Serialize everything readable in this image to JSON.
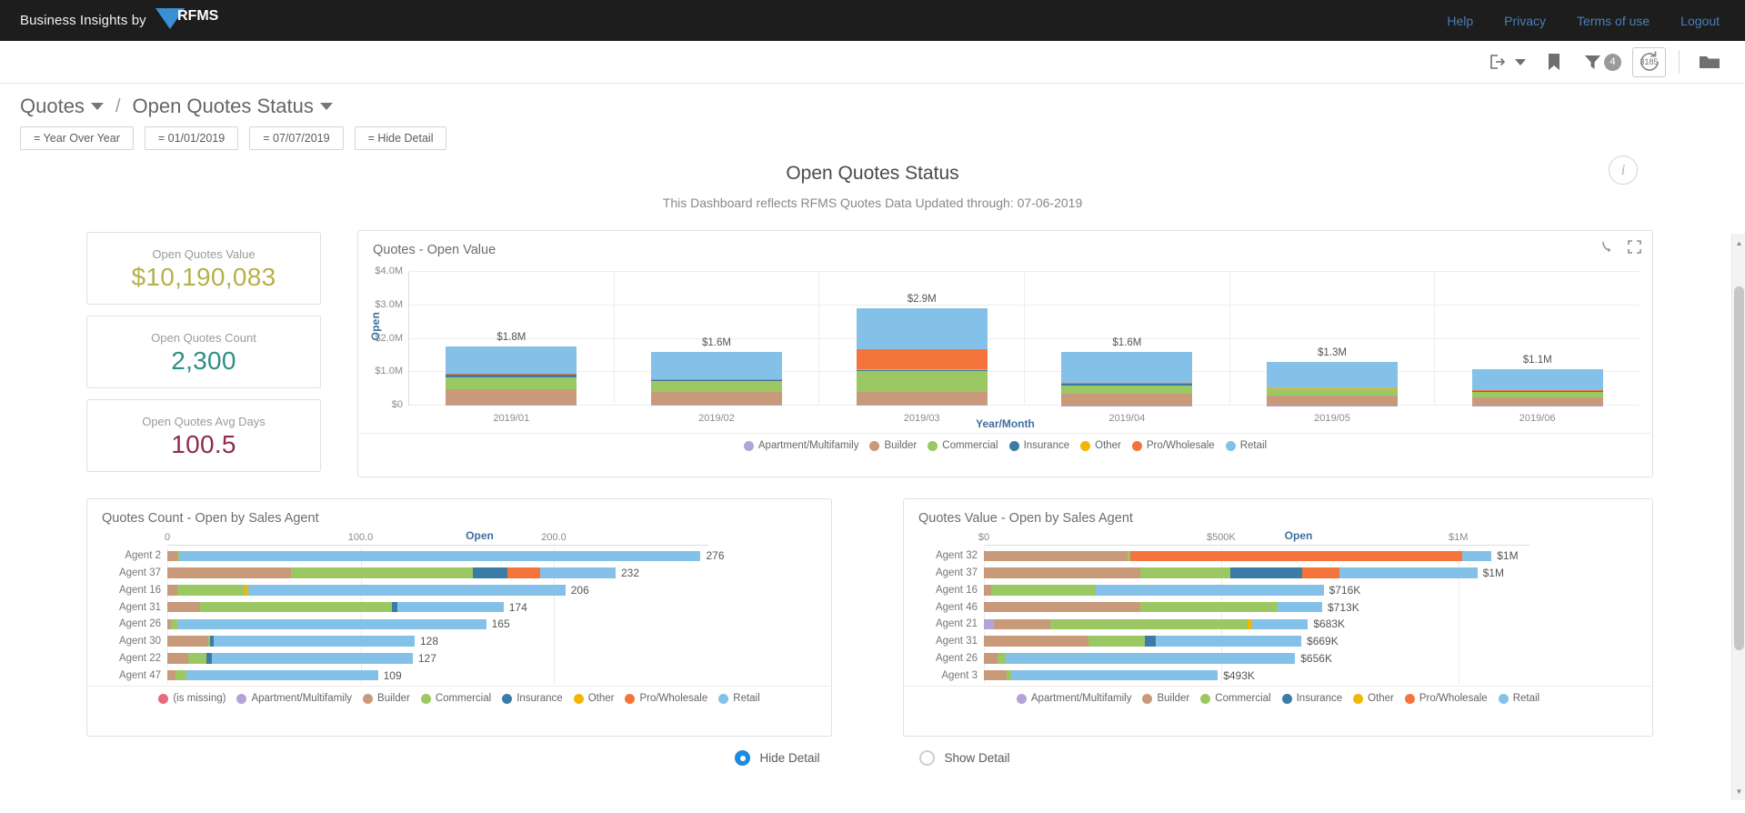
{
  "header": {
    "brand_text": "Business Insights by",
    "logo_text": "RFMS",
    "nav": [
      {
        "label": "Help"
      },
      {
        "label": "Privacy"
      },
      {
        "label": "Terms of use"
      },
      {
        "label": "Logout"
      }
    ]
  },
  "toolbar": {
    "export_icon": "export-icon",
    "bookmark_icon": "bookmark-icon",
    "filter_icon": "filter-icon",
    "filter_badge": "4",
    "refresh_icon": "refresh-icon",
    "refresh_count": "3185",
    "folder_icon": "folder-icon"
  },
  "breadcrumb": {
    "root": "Quotes",
    "separator": "/",
    "current": "Open Quotes Status",
    "chips": [
      {
        "label": "= Year Over Year"
      },
      {
        "label": "= 01/01/2019"
      },
      {
        "label": "= 07/07/2019"
      },
      {
        "label": "= Hide Detail"
      }
    ]
  },
  "dashboard": {
    "title": "Open Quotes Status",
    "subtitle": "This Dashboard reflects RFMS Quotes Data Updated through: 07-06-2019",
    "info_icon": "info-icon"
  },
  "kpis": [
    {
      "label": "Open Quotes Value",
      "value": "$10,190,083",
      "color": "#b5b14a"
    },
    {
      "label": "Open Quotes Count",
      "value": "2,300",
      "color": "#2e8f86"
    },
    {
      "label": "Open Quotes Avg Days",
      "value": "100.5",
      "color": "#8f2d4c"
    }
  ],
  "category_colors": {
    "(is missing)": "#e8697d",
    "Apartment/Multifamily": "#b3a3d8",
    "Builder": "#c89a79",
    "Commercial": "#9cc863",
    "Insurance": "#3a7ca5",
    "Other": "#f2b705",
    "Pro/Wholesale": "#f4743b",
    "Retail": "#84c1e8"
  },
  "chart_data": [
    {
      "id": "open-value",
      "type": "bar",
      "title": "Quotes - Open Value",
      "xlabel": "Year/Month",
      "ylabel": "Open",
      "categories": [
        "2019/01",
        "2019/02",
        "2019/03",
        "2019/04",
        "2019/05",
        "2019/06"
      ],
      "ylim": [
        0,
        4000000
      ],
      "yticks": [
        "$0",
        "$1.0M",
        "$2.0M",
        "$3.0M",
        "$4.0M"
      ],
      "ytick_values": [
        0,
        1000000,
        2000000,
        3000000,
        4000000
      ],
      "data_labels": [
        "$1.8M",
        "$1.6M",
        "$2.9M",
        "$1.6M",
        "$1.3M",
        "$1.1M"
      ],
      "totals": [
        1780000,
        1600000,
        2900000,
        1600000,
        1300000,
        1100000
      ],
      "legend_position": "bottom",
      "legend": [
        "Apartment/Multifamily",
        "Builder",
        "Commercial",
        "Insurance",
        "Other",
        "Pro/Wholesale",
        "Retail"
      ],
      "series": [
        {
          "name": "Apartment/Multifamily",
          "values": [
            20000,
            15000,
            15000,
            12000,
            10000,
            10000
          ]
        },
        {
          "name": "Builder",
          "values": [
            480000,
            400000,
            390000,
            330000,
            290000,
            230000
          ]
        },
        {
          "name": "Commercial",
          "values": [
            350000,
            310000,
            640000,
            270000,
            180000,
            170000
          ]
        },
        {
          "name": "Insurance",
          "values": [
            70000,
            25000,
            20000,
            30000,
            20000,
            20000
          ]
        },
        {
          "name": "Other",
          "values": [
            15000,
            15000,
            15000,
            12000,
            10000,
            10000
          ]
        },
        {
          "name": "Pro/Wholesale",
          "values": [
            15000,
            15000,
            610000,
            20000,
            15000,
            15000
          ]
        },
        {
          "name": "Retail",
          "values": [
            830000,
            820000,
            1210000,
            926000,
            775000,
            645000
          ]
        }
      ],
      "panel_icons": [
        "drill-down-icon",
        "expand-icon"
      ]
    },
    {
      "id": "count-by-agent",
      "type": "bar",
      "orientation": "horizontal",
      "title": "Quotes Count - Open by Sales Agent",
      "axis_title": "Open",
      "xticks": [
        "0",
        "100.0",
        "200.0"
      ],
      "xtick_values": [
        0,
        100,
        200
      ],
      "xlim": [
        0,
        280
      ],
      "categories": [
        "Agent 2",
        "Agent 37",
        "Agent 16",
        "Agent 31",
        "Agent 26",
        "Agent 30",
        "Agent 22",
        "Agent 47"
      ],
      "data_labels": [
        "276",
        "232",
        "206",
        "174",
        "165",
        "128",
        "127",
        "109"
      ],
      "totals": [
        276,
        232,
        206,
        174,
        165,
        128,
        127,
        109
      ],
      "legend_position": "bottom",
      "legend": [
        "(is missing)",
        "Apartment/Multifamily",
        "Builder",
        "Commercial",
        "Insurance",
        "Other",
        "Pro/Wholesale",
        "Retail"
      ],
      "series": [
        {
          "name": "(is missing)",
          "values": [
            0,
            0,
            0,
            0,
            0,
            0,
            0,
            0
          ]
        },
        {
          "name": "Apartment/Multifamily",
          "values": [
            0,
            0,
            0,
            0,
            0,
            0,
            0,
            0
          ]
        },
        {
          "name": "Builder",
          "values": [
            5,
            64,
            5,
            17,
            2,
            21,
            11,
            4
          ]
        },
        {
          "name": "Commercial",
          "values": [
            1,
            94,
            35,
            99,
            3,
            1,
            9,
            6
          ]
        },
        {
          "name": "Insurance",
          "values": [
            0,
            18,
            0,
            3,
            0,
            2,
            3,
            0
          ]
        },
        {
          "name": "Other",
          "values": [
            0,
            0,
            2,
            0,
            0,
            0,
            0,
            0
          ]
        },
        {
          "name": "Pro/Wholesale",
          "values": [
            0,
            17,
            0,
            0,
            0,
            0,
            0,
            0
          ]
        },
        {
          "name": "Retail",
          "values": [
            270,
            39,
            164,
            55,
            160,
            104,
            104,
            99
          ]
        }
      ]
    },
    {
      "id": "value-by-agent",
      "type": "bar",
      "orientation": "horizontal",
      "title": "Quotes Value - Open by Sales Agent",
      "axis_title": "Open",
      "xticks": [
        "$0",
        "$500K",
        "$1M"
      ],
      "xtick_values": [
        0,
        500000,
        1000000
      ],
      "xlim": [
        0,
        1150000
      ],
      "categories": [
        "Agent 32",
        "Agent 37",
        "Agent 16",
        "Agent 46",
        "Agent 21",
        "Agent 31",
        "Agent 26",
        "Agent 3"
      ],
      "data_labels": [
        "$1M",
        "$1M",
        "$716K",
        "$713K",
        "$683K",
        "$669K",
        "$656K",
        "$493K"
      ],
      "totals": [
        1070000,
        1040000,
        716000,
        713000,
        683000,
        669000,
        656000,
        493000
      ],
      "legend_position": "bottom",
      "legend": [
        "Apartment/Multifamily",
        "Builder",
        "Commercial",
        "Insurance",
        "Other",
        "Pro/Wholesale",
        "Retail"
      ],
      "series": [
        {
          "name": "Apartment/Multifamily",
          "values": [
            0,
            0,
            0,
            0,
            22000,
            0,
            0,
            0
          ]
        },
        {
          "name": "Builder",
          "values": [
            302000,
            330000,
            16000,
            330000,
            118000,
            220000,
            28000,
            48000
          ]
        },
        {
          "name": "Commercial",
          "values": [
            6000,
            190000,
            220000,
            290000,
            415000,
            120000,
            18000,
            10000
          ]
        },
        {
          "name": "Insurance",
          "values": [
            0,
            150000,
            0,
            0,
            0,
            22000,
            0,
            0
          ]
        },
        {
          "name": "Other",
          "values": [
            0,
            0,
            0,
            0,
            10000,
            0,
            0,
            0
          ]
        },
        {
          "name": "Pro/Wholesale",
          "values": [
            700000,
            80000,
            0,
            0,
            0,
            0,
            0,
            0
          ]
        },
        {
          "name": "Retail",
          "values": [
            62000,
            290000,
            480000,
            93000,
            118000,
            307000,
            610000,
            435000
          ]
        }
      ]
    }
  ],
  "detail_toggle": {
    "options": [
      {
        "label": "Hide Detail",
        "selected": true
      },
      {
        "label": "Show Detail",
        "selected": false
      }
    ]
  }
}
